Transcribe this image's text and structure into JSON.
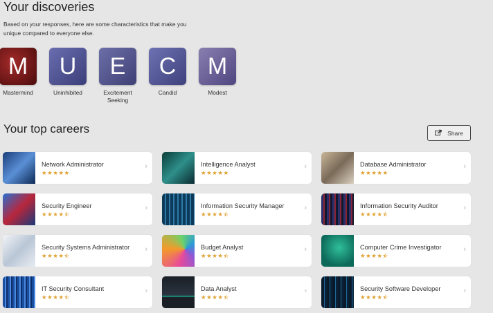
{
  "discoveries": {
    "title": "Your discoveries",
    "description": "Based on your responses, here are some characteristics that make you unique compared to everyone else.",
    "traits": [
      {
        "letter": "M",
        "label": "Mastermind",
        "color": "#7a1b1b"
      },
      {
        "letter": "U",
        "label": "Uninhibited",
        "color": "#4a4d8a"
      },
      {
        "letter": "E",
        "label": "Excitement Seeking",
        "color": "#4e4f86"
      },
      {
        "letter": "C",
        "label": "Candid",
        "color": "#50548c"
      },
      {
        "letter": "M",
        "label": "Modest",
        "color": "#6a5f8e"
      }
    ]
  },
  "careers": {
    "title": "Your top careers",
    "share_label": "Share",
    "items": [
      {
        "title": "Network Administrator",
        "rating": "★★★★★"
      },
      {
        "title": "Intelligence Analyst",
        "rating": "★★★★★"
      },
      {
        "title": "Database Administrator",
        "rating": "★★★★★"
      },
      {
        "title": "Security Engineer",
        "rating": "★★★★⯪"
      },
      {
        "title": "Information Security Manager",
        "rating": "★★★★⯪"
      },
      {
        "title": "Information Security Auditor",
        "rating": "★★★★⯪"
      },
      {
        "title": "Security Systems Administrator",
        "rating": "★★★★⯪"
      },
      {
        "title": "Budget Analyst",
        "rating": "★★★★⯪"
      },
      {
        "title": "Computer Crime Investigator",
        "rating": "★★★★⯪"
      },
      {
        "title": "IT Security Consultant",
        "rating": "★★★★⯪"
      },
      {
        "title": "Data Analyst",
        "rating": "★★★★⯪"
      },
      {
        "title": "Security Software Developer",
        "rating": "★★★★⯪"
      }
    ]
  },
  "colors": {
    "star": "#e0a030",
    "card_bg": "#ffffff",
    "page_bg": "#e6e6e6"
  }
}
